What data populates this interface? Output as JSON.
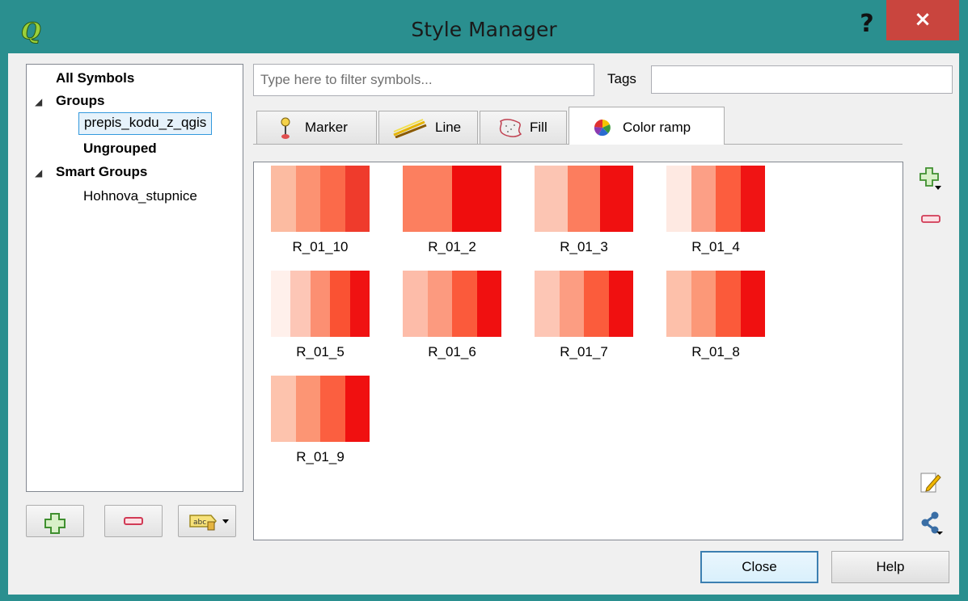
{
  "window": {
    "title": "Style Manager",
    "help_glyph": "?",
    "close_glyph": "×",
    "accent": "#2a8f8f",
    "close_color": "#c9453e"
  },
  "tree": {
    "all_symbols": "All Symbols",
    "groups": "Groups",
    "group_item": "prepis_kodu_z_qgis",
    "ungrouped": "Ungrouped",
    "smart_groups": "Smart Groups",
    "smart_item": "Hohnova_stupnice"
  },
  "filter": {
    "placeholder": "Type here to filter symbols...",
    "value": ""
  },
  "tags": {
    "label": "Tags",
    "value": ""
  },
  "tabs": [
    {
      "label": "Marker",
      "icon": "marker-icon"
    },
    {
      "label": "Line",
      "icon": "line-icon"
    },
    {
      "label": "Fill",
      "icon": "fill-icon"
    },
    {
      "label": "Color ramp",
      "icon": "color-wheel-icon",
      "active": true
    }
  ],
  "ramps": [
    {
      "name": "R_01_10",
      "colors": [
        "#fcbba1",
        "#fc9272",
        "#fb6a4a",
        "#ef3b2c"
      ]
    },
    {
      "name": "R_01_2",
      "colors": [
        "#fc7f5f",
        "#ef0d0d"
      ]
    },
    {
      "name": "R_01_3",
      "colors": [
        "#fcc5b3",
        "#fc7d5e",
        "#f01010"
      ]
    },
    {
      "name": "R_01_4",
      "colors": [
        "#fee9e2",
        "#fc9f86",
        "#fc5d3e",
        "#f01414"
      ]
    },
    {
      "name": "R_01_5",
      "colors": [
        "#fff0eb",
        "#fdc6b6",
        "#fc8f72",
        "#fa5233",
        "#f01212"
      ]
    },
    {
      "name": "R_01_6",
      "colors": [
        "#fdbca9",
        "#fc9a7f",
        "#fb5a3b",
        "#f01010"
      ]
    },
    {
      "name": "R_01_7",
      "colors": [
        "#fdc6b5",
        "#fc9d82",
        "#fb5c3c",
        "#f01010"
      ]
    },
    {
      "name": "R_01_8",
      "colors": [
        "#fdc0aa",
        "#fc9878",
        "#fb5a3a",
        "#f01010"
      ]
    },
    {
      "name": "R_01_9",
      "colors": [
        "#fdc3ad",
        "#fc9574",
        "#fb5f40",
        "#f01010"
      ]
    }
  ],
  "buttons": {
    "close": "Close",
    "help": "Help"
  }
}
